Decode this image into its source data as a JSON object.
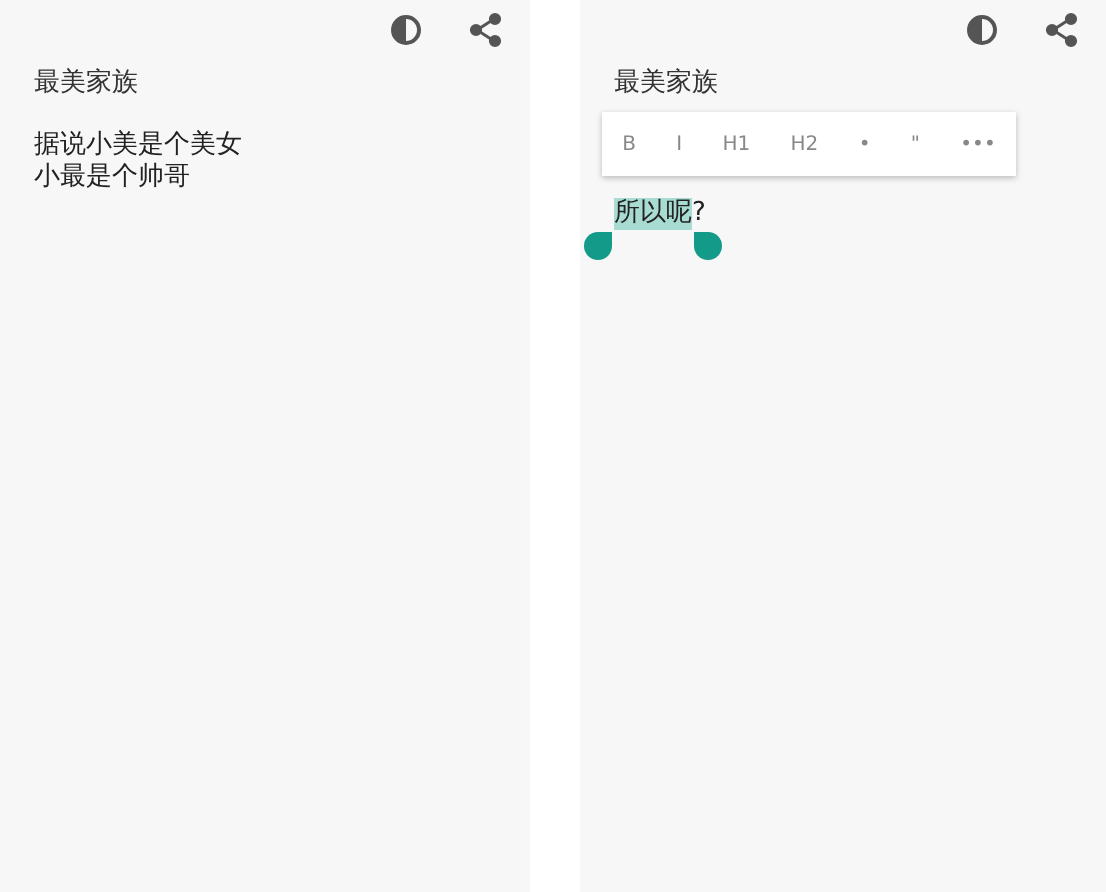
{
  "screens": [
    {
      "title": "最美家族",
      "lines": [
        {
          "segments": [
            {
              "text": "据说小美是个美女",
              "selected": false
            }
          ]
        },
        {
          "segments": [
            {
              "text": "小最是个帅哥",
              "selected": false
            }
          ]
        }
      ]
    },
    {
      "title": "最美家族",
      "toolbar": {
        "buttons": [
          "B",
          "I",
          "H1",
          "H2",
          "•",
          "\"",
          "•••"
        ]
      },
      "lines": [
        {
          "segments": [
            {
              "text": "所以呢",
              "selected": true
            },
            {
              "text": "?",
              "selected": false
            }
          ]
        }
      ]
    }
  ]
}
